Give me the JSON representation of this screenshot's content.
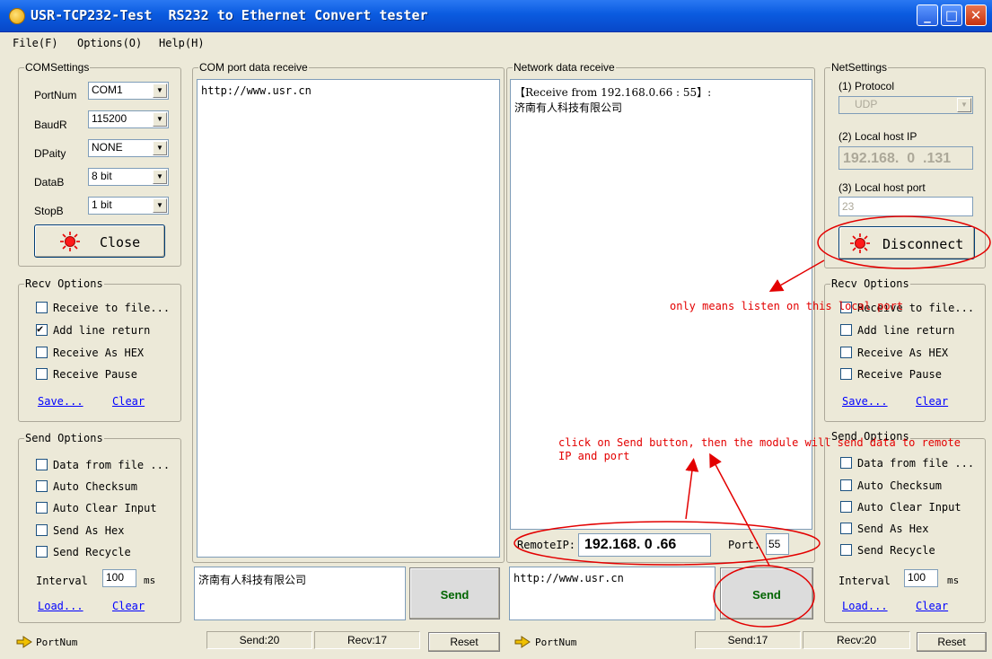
{
  "window": {
    "title": "USR-TCP232-Test  RS232 to Ethernet Convert tester",
    "controls": {
      "minimize": "_",
      "maximize": "□",
      "close": "✕"
    }
  },
  "menu": [
    "File(F)",
    "Options(O)",
    "Help(H)"
  ],
  "com_settings": {
    "title": "COMSettings",
    "fields": [
      {
        "label": "PortNum",
        "value": "COM1"
      },
      {
        "label": "BaudR",
        "value": "115200"
      },
      {
        "label": "DPaity",
        "value": "NONE"
      },
      {
        "label": "DataB",
        "value": "8 bit"
      },
      {
        "label": "StopB",
        "value": "1 bit"
      }
    ],
    "button": "Close"
  },
  "com_recv": {
    "title": "COM port data receive",
    "content": "http://www.usr.cn"
  },
  "net_recv": {
    "title": "Network data receive",
    "content": "【Receive from 192.168.0.66 : 55】:\n济南有人科技有限公司"
  },
  "net_settings": {
    "title": "NetSettings",
    "protocol_label": "(1) Protocol",
    "protocol_value": "UDP",
    "host_ip_label": "(2) Local host IP",
    "host_ip": [
      "192",
      "168",
      "0",
      "131"
    ],
    "host_port_label": "(3) Local host port",
    "host_port": "23",
    "button": "Disconnect"
  },
  "recv_options_left": {
    "title": "Recv Options",
    "options": [
      {
        "label": "Receive to file...",
        "checked": false
      },
      {
        "label": "Add line return",
        "checked": true
      },
      {
        "label": "Receive As HEX",
        "checked": false
      },
      {
        "label": "Receive Pause",
        "checked": false
      }
    ],
    "save": "Save...",
    "clear": "Clear"
  },
  "recv_options_right": {
    "title": "Recv Options",
    "options": [
      {
        "label": "Receive to file...",
        "checked": false
      },
      {
        "label": "Add line return",
        "checked": false
      },
      {
        "label": "Receive As HEX",
        "checked": false
      },
      {
        "label": "Receive Pause",
        "checked": false
      }
    ],
    "save": "Save...",
    "clear": "Clear"
  },
  "send_options_left": {
    "title": "Send Options",
    "options": [
      {
        "label": "Data from file ...",
        "checked": false
      },
      {
        "label": "Auto Checksum",
        "checked": false
      },
      {
        "label": "Auto Clear Input",
        "checked": false
      },
      {
        "label": "Send As Hex",
        "checked": false
      },
      {
        "label": "Send Recycle",
        "checked": false
      }
    ],
    "interval_label": "Interval",
    "interval_value": "100",
    "interval_unit": "ms",
    "load": "Load...",
    "clear": "Clear"
  },
  "send_options_right": {
    "title": "Send Options",
    "options": [
      {
        "label": "Data from file ...",
        "checked": false
      },
      {
        "label": "Auto Checksum",
        "checked": false
      },
      {
        "label": "Auto Clear Input",
        "checked": false
      },
      {
        "label": "Send As Hex",
        "checked": false
      },
      {
        "label": "Send Recycle",
        "checked": false
      }
    ],
    "interval_label": "Interval",
    "interval_value": "100",
    "interval_unit": "ms",
    "load": "Load...",
    "clear": "Clear"
  },
  "remote": {
    "ip_label": "RemoteIP:",
    "ip": "192.168. 0 .66",
    "port_label": "Port:",
    "port": "55"
  },
  "com_send": {
    "content": "济南有人科技有限公司",
    "button": "Send"
  },
  "net_send": {
    "content": "http://www.usr.cn",
    "button": "Send"
  },
  "status": {
    "left_label": "PortNum",
    "left_send": "Send:20",
    "left_recv": "Recv:17",
    "left_reset": "Reset",
    "right_label": "PortNum",
    "right_send": "Send:17",
    "right_recv": "Recv:20",
    "right_reset": "Reset"
  },
  "annotations": {
    "listen": "only means listen on this local port",
    "send_line1": "click on Send button, then the module will send data to remote",
    "send_line2": "IP and port"
  },
  "colors": {
    "annotation": "#e30000",
    "title_bar": "#0a5be0",
    "link": "#0000ff"
  }
}
